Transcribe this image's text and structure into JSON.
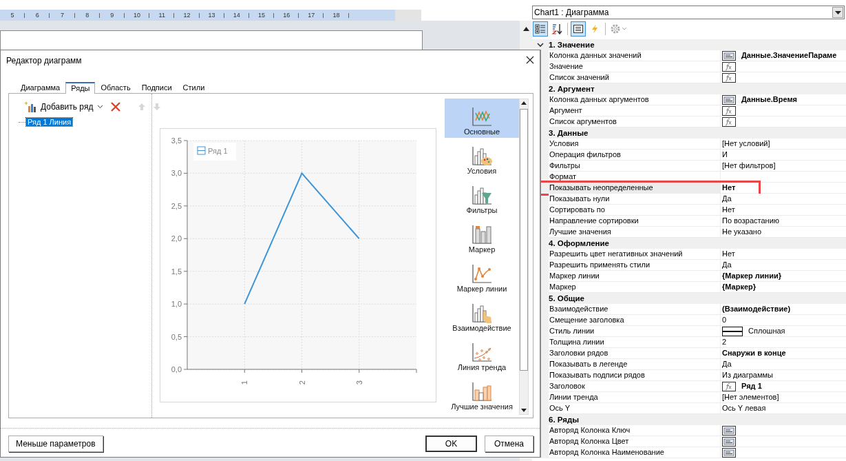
{
  "designer": {
    "ruler": [
      "5",
      "6",
      "7",
      "8",
      "9",
      "10",
      "11",
      "12",
      "13",
      "14",
      "15",
      "16",
      "17",
      "18"
    ]
  },
  "dialog": {
    "title": "Редактор диаграмм",
    "tabs": [
      {
        "label": "Диаграмма",
        "selected": false
      },
      {
        "label": "Ряды",
        "selected": true
      },
      {
        "label": "Область",
        "selected": false
      },
      {
        "label": "Подписи",
        "selected": false
      },
      {
        "label": "Стили",
        "selected": false
      }
    ],
    "toolbar": [
      {
        "kind": "add",
        "label": "Добавить ряд",
        "disabled": false
      },
      {
        "kind": "delete",
        "disabled": false
      },
      {
        "kind": "move_up",
        "disabled": true
      },
      {
        "kind": "move_down",
        "disabled": true
      }
    ],
    "tree": [
      {
        "label": "Ряд 1 Линия",
        "selected": true
      }
    ],
    "chart": {
      "chart_data": {
        "type": "line",
        "categories": [
          "1",
          "2",
          "3"
        ],
        "ylim": [
          0,
          3.5
        ],
        "grid": true,
        "yticks": [
          {
            "value": 0,
            "label": "0,0"
          },
          {
            "value": 0.5,
            "label": "0,5"
          },
          {
            "value": 1,
            "label": "1,0"
          },
          {
            "value": 1.5,
            "label": "1,5"
          },
          {
            "value": 2,
            "label": "2,0"
          },
          {
            "value": 2.5,
            "label": "2,5"
          },
          {
            "value": 3,
            "label": "3,0"
          },
          {
            "value": 3.5,
            "label": "3,5"
          }
        ],
        "series": [
          {
            "name": "Ряд 1",
            "color": "#3d95d8",
            "values": [
              1,
              3,
              2
            ]
          }
        ]
      }
    },
    "categories": [
      {
        "kind": "basic",
        "label": "Основные",
        "selected": true
      },
      {
        "kind": "conditions",
        "label": "Условия",
        "selected": false
      },
      {
        "kind": "filters",
        "label": "Фильтры",
        "selected": false
      },
      {
        "kind": "marker",
        "label": "Маркер",
        "selected": false
      },
      {
        "kind": "line_marker",
        "label": "Маркер линии",
        "selected": false
      },
      {
        "kind": "interaction",
        "label": "Взаимодействие",
        "selected": false
      },
      {
        "kind": "trend",
        "label": "Линия тренда",
        "selected": false
      },
      {
        "kind": "top",
        "label": "Лучшие значения",
        "selected": false
      }
    ],
    "buttons": [
      {
        "kind": "less",
        "label": "Меньше параметров"
      },
      {
        "kind": "ok",
        "label": "OK"
      },
      {
        "kind": "cancel",
        "label": "Отмена"
      }
    ]
  },
  "properties": {
    "object": "Chart1 : Диаграмма",
    "toolbar": [
      {
        "kind": "categorized",
        "selected": true,
        "disabled": false
      },
      {
        "kind": "alphabetical",
        "selected": false,
        "disabled": false
      },
      {
        "kind": "properties",
        "selected": true,
        "disabled": false
      },
      {
        "kind": "events",
        "selected": false,
        "disabled": false
      },
      {
        "kind": "settings",
        "selected": false,
        "disabled": true
      }
    ],
    "rows": [
      {
        "kind": "category",
        "label": "1. Значение",
        "collapse_toggle": true
      },
      {
        "kind": "column",
        "name": "Колонка данных значений",
        "value": "Данные.ЗначениеПараме",
        "bold": true,
        "selected": false,
        "highlighted": false
      },
      {
        "kind": "expression",
        "name": "Значение",
        "selected": false,
        "highlighted": false
      },
      {
        "kind": "expression",
        "name": "Список значений",
        "selected": false,
        "highlighted": false
      },
      {
        "kind": "category",
        "label": "2. Аргумент",
        "collapse_toggle": false
      },
      {
        "kind": "column",
        "name": "Колонка данных аргументов",
        "value": "Данные.Время",
        "bold": true,
        "selected": false,
        "highlighted": false
      },
      {
        "kind": "expression",
        "name": "Аргумент",
        "selected": false,
        "highlighted": false
      },
      {
        "kind": "expression",
        "name": "Список аргументов",
        "selected": false,
        "highlighted": false
      },
      {
        "kind": "category",
        "label": "3. Данные",
        "collapse_toggle": false
      },
      {
        "kind": "property",
        "name": "Условия",
        "value": "[Нет условий]",
        "bold": false,
        "selected": false,
        "highlighted": false
      },
      {
        "kind": "property",
        "name": "Операция фильтров",
        "value": "И",
        "bold": false,
        "selected": false,
        "highlighted": false
      },
      {
        "kind": "property",
        "name": "Фильтры",
        "value": "[Нет фильтров]",
        "bold": false,
        "selected": false,
        "highlighted": false
      },
      {
        "kind": "property",
        "name": "Формат",
        "selected": false,
        "highlighted": false
      },
      {
        "kind": "property",
        "name": "Показывать неопределенные",
        "value": "Нет",
        "bold": true,
        "selected": true,
        "highlighted": true
      },
      {
        "kind": "property",
        "name": "Показывать нули",
        "value": "Да",
        "bold": false,
        "selected": false,
        "highlighted": false
      },
      {
        "kind": "property",
        "name": "Сортировать по",
        "value": "Нет",
        "bold": false,
        "selected": false,
        "highlighted": false
      },
      {
        "kind": "property",
        "name": "Направление сортировки",
        "value": "По возрастанию",
        "bold": false,
        "selected": false,
        "highlighted": false
      },
      {
        "kind": "property",
        "name": "Лучшие значения",
        "value": "Не указано",
        "bold": false,
        "selected": false,
        "highlighted": false
      },
      {
        "kind": "category",
        "label": "4. Оформление",
        "collapse_toggle": false
      },
      {
        "kind": "property",
        "name": "Разрешить цвет негативных значений",
        "value": "Нет",
        "bold": false,
        "selected": false,
        "highlighted": false
      },
      {
        "kind": "property",
        "name": "Разрешить применять стили",
        "value": "Да",
        "bold": false,
        "selected": false,
        "highlighted": false
      },
      {
        "kind": "property",
        "name": "Маркер линии",
        "value": "{Маркер линии}",
        "bold": true,
        "selected": false,
        "highlighted": false
      },
      {
        "kind": "property",
        "name": "Маркер",
        "value": "{Маркер}",
        "bold": true,
        "selected": false,
        "highlighted": false
      },
      {
        "kind": "category",
        "label": "5. Общие",
        "collapse_toggle": false
      },
      {
        "kind": "property",
        "name": "Взаимодействие",
        "value": "(Взаимодействие)",
        "bold": true,
        "selected": false,
        "highlighted": false
      },
      {
        "kind": "property",
        "name": "Смещение заголовка",
        "value": "0",
        "bold": false,
        "selected": false,
        "highlighted": false
      },
      {
        "kind": "line_style",
        "name": "Стиль линии",
        "value": "Сплошная",
        "bold": false,
        "selected": false,
        "highlighted": false
      },
      {
        "kind": "property",
        "name": "Толщина линии",
        "value": "2",
        "bold": false,
        "selected": false,
        "highlighted": false
      },
      {
        "kind": "property",
        "name": "Заголовки рядов",
        "value": "Снаружи в конце",
        "bold": true,
        "selected": false,
        "highlighted": false
      },
      {
        "kind": "property",
        "name": "Показывать в легенде",
        "value": "Да",
        "bold": false,
        "selected": false,
        "highlighted": false
      },
      {
        "kind": "property",
        "name": "Показывать подписи рядов",
        "value": "Из диаграммы",
        "bold": false,
        "selected": false,
        "highlighted": false
      },
      {
        "kind": "expression",
        "name": "Заголовок",
        "value": "Ряд 1",
        "bold": true,
        "selected": false,
        "highlighted": false
      },
      {
        "kind": "property",
        "name": "Линии тренда",
        "value": "[Нет элементов]",
        "bold": false,
        "selected": false,
        "highlighted": false
      },
      {
        "kind": "property",
        "name": "Ось Y",
        "value": "Ось Y левая",
        "bold": false,
        "selected": false,
        "highlighted": false
      },
      {
        "kind": "category",
        "label": "6. Ряды",
        "collapse_toggle": false
      },
      {
        "kind": "column",
        "name": "Авторяд Колонка Ключ",
        "selected": false,
        "highlighted": false
      },
      {
        "kind": "column",
        "name": "Авторяд Колонка Цвет",
        "selected": false,
        "highlighted": false
      },
      {
        "kind": "column",
        "name": "Авторяд Колонка Наименование",
        "selected": false,
        "highlighted": false
      }
    ]
  }
}
